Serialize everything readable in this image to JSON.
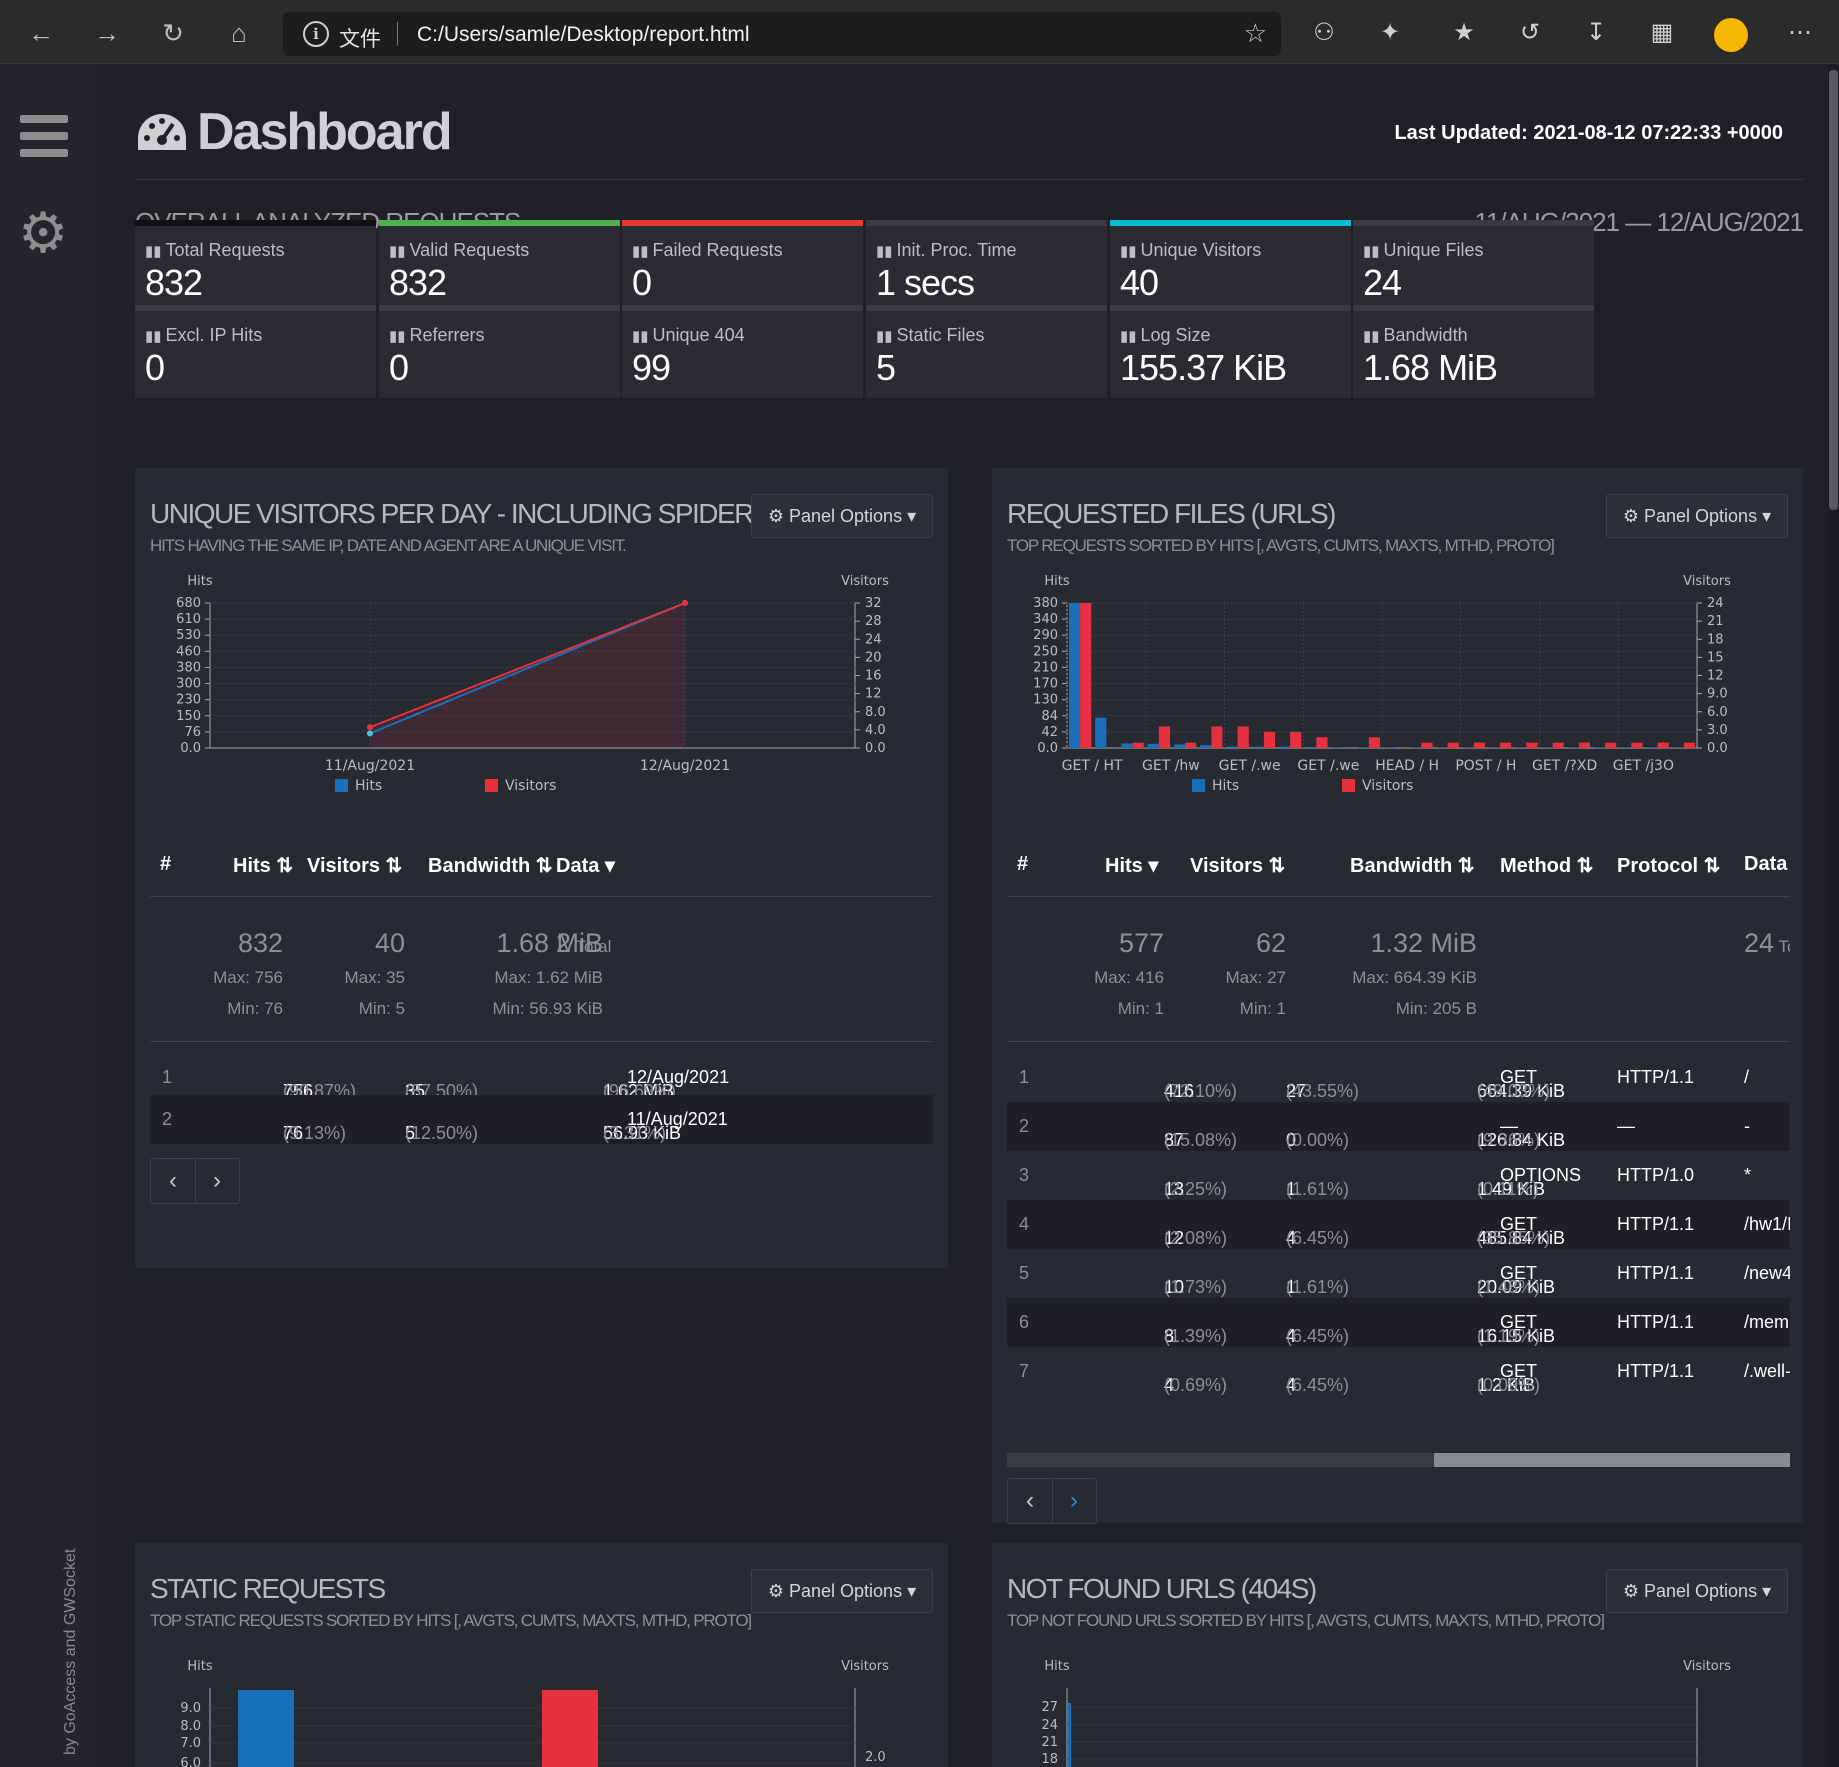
{
  "browser": {
    "file_label": "文件",
    "url": "C:/Users/samle/Desktop/report.html"
  },
  "sidebar": {
    "credit": "by GoAccess and GWSocket"
  },
  "header": {
    "title": "Dashboard",
    "last_updated": "Last Updated: 2021-08-12 07:22:33 +0000"
  },
  "overview": {
    "title": "OVERALL ANALYZED REQUESTS",
    "date_range": "11/AUG/2021 — 12/AUG/2021",
    "cards": [
      {
        "label": "Total Requests",
        "value": "832",
        "accent": "#111111"
      },
      {
        "label": "Valid Requests",
        "value": "832",
        "accent": "#4caf50"
      },
      {
        "label": "Failed Requests",
        "value": "0",
        "accent": "#e53935"
      },
      {
        "label": "Init. Proc. Time",
        "value": "1 secs",
        "accent": "#3a3c42"
      },
      {
        "label": "Unique Visitors",
        "value": "40",
        "accent": "#00bcd4"
      },
      {
        "label": "Unique Files",
        "value": "24",
        "accent": "#3a3c42"
      },
      {
        "label": "Excl. IP Hits",
        "value": "0",
        "accent": "#3a3c42"
      },
      {
        "label": "Referrers",
        "value": "0",
        "accent": "#3a3c42"
      },
      {
        "label": "Unique 404",
        "value": "99",
        "accent": "#3a3c42"
      },
      {
        "label": "Static Files",
        "value": "5",
        "accent": "#3a3c42"
      },
      {
        "label": "Log Size",
        "value": "155.37 KiB",
        "accent": "#3a3c42"
      },
      {
        "label": "Bandwidth",
        "value": "1.68 MiB",
        "accent": "#3a3c42"
      }
    ]
  },
  "panel_options_label": "Panel Options",
  "visitors_panel": {
    "title": "UNIQUE VISITORS PER DAY - INCLUDING SPIDERS",
    "subtitle": "HITS HAVING THE SAME IP, DATE AND AGENT ARE A UNIQUE VISIT.",
    "columns": [
      "#",
      "Hits",
      "Visitors",
      "Bandwidth",
      "Data"
    ],
    "summary": {
      "hits": "832",
      "hits_max": "Max: 756",
      "hits_min": "Min: 76",
      "visitors": "40",
      "visitors_max": "Max: 35",
      "visitors_min": "Min: 5",
      "bw": "1.68 MiB",
      "bw_max": "Max: 1.62 MiB",
      "bw_min": "Min: 56.93 KiB",
      "data": "2",
      "data_label": "Total"
    },
    "rows": [
      {
        "n": "1",
        "hits": "756",
        "hits_pct": "(90.87%)",
        "vis": "35",
        "vis_pct": "(87.50%)",
        "bw": "1.62 MiB",
        "bw_pct": "(96.69%)",
        "data": "12/Aug/2021"
      },
      {
        "n": "2",
        "hits": "76",
        "hits_pct": "(9.13%)",
        "vis": "5",
        "vis_pct": "(12.50%)",
        "bw": "56.93 KiB",
        "bw_pct": "(3.31%)",
        "data": "11/Aug/2021"
      }
    ]
  },
  "files_panel": {
    "title": "REQUESTED FILES (URLS)",
    "subtitle": "TOP REQUESTS SORTED BY HITS [, AVGTS, CUMTS, MAXTS, MTHD, PROTO]",
    "columns": [
      "#",
      "Hits",
      "Visitors",
      "Bandwidth",
      "Method",
      "Protocol",
      "Data"
    ],
    "summary": {
      "hits": "577",
      "hits_max": "Max: 416",
      "hits_min": "Min: 1",
      "visitors": "62",
      "visitors_max": "Max: 27",
      "visitors_min": "Min: 1",
      "bw": "1.32 MiB",
      "bw_max": "Max: 664.39 KiB",
      "bw_min": "Min: 205 B",
      "data": "24",
      "data_label": "Tc"
    },
    "rows": [
      {
        "n": "1",
        "hits": "416",
        "hits_pct": "(72.10%)",
        "vis": "27",
        "vis_pct": "(43.55%)",
        "bw": "664.39 KiB",
        "bw_pct": "(49.03%)",
        "method": "GET",
        "proto": "HTTP/1.1",
        "data": "/"
      },
      {
        "n": "2",
        "hits": "87",
        "hits_pct": "(15.08%)",
        "vis": "0",
        "vis_pct": "(0.00%)",
        "bw": "126.84 KiB",
        "bw_pct": "(9.36%)",
        "method": "—",
        "proto": "—",
        "data": "-"
      },
      {
        "n": "3",
        "hits": "13",
        "hits_pct": "(2.25%)",
        "vis": "1",
        "vis_pct": "(1.61%)",
        "bw": "1.49 KiB",
        "bw_pct": "(0.11%)",
        "method": "OPTIONS",
        "proto": "HTTP/1.0",
        "data": "*"
      },
      {
        "n": "4",
        "hits": "12",
        "hits_pct": "(2.08%)",
        "vis": "4",
        "vis_pct": "(6.45%)",
        "bw": "485.84 KiB",
        "bw_pct": "(35.85%)",
        "method": "GET",
        "proto": "HTTP/1.1",
        "data": "/hw1/I"
      },
      {
        "n": "5",
        "hits": "10",
        "hits_pct": "(1.73%)",
        "vis": "1",
        "vis_pct": "(1.61%)",
        "bw": "20.09 KiB",
        "bw_pct": "(1.48%)",
        "method": "GET",
        "proto": "HTTP/1.1",
        "data": "/new4"
      },
      {
        "n": "6",
        "hits": "8",
        "hits_pct": "(1.39%)",
        "vis": "4",
        "vis_pct": "(6.45%)",
        "bw": "16.15 KiB",
        "bw_pct": "(1.19%)",
        "method": "GET",
        "proto": "HTTP/1.1",
        "data": "/meml"
      },
      {
        "n": "7",
        "hits": "4",
        "hits_pct": "(0.69%)",
        "vis": "4",
        "vis_pct": "(6.45%)",
        "bw": "1.2 KiB",
        "bw_pct": "(0.09%)",
        "method": "GET",
        "proto": "HTTP/1.1",
        "data": "/.well-"
      }
    ]
  },
  "static_panel": {
    "title": "STATIC REQUESTS",
    "subtitle": "TOP STATIC REQUESTS SORTED BY HITS [, AVGTS, CUMTS, MAXTS, MTHD, PROTO]"
  },
  "notfound_panel": {
    "title": "NOT FOUND URLS (404S)",
    "subtitle": "TOP NOT FOUND URLS SORTED BY HITS [, AVGTS, CUMTS, MAXTS, MTHD, PROTO]"
  },
  "chart_data": [
    {
      "type": "line",
      "x": [
        "11/Aug/2021",
        "12/Aug/2021"
      ],
      "series": [
        {
          "name": "Hits",
          "values": [
            76,
            756
          ],
          "color": "#1a6fbd"
        },
        {
          "name": "Visitors",
          "values": [
            5,
            35
          ],
          "color": "#e8313f"
        }
      ],
      "ylabel": "Hits",
      "y2label": "Visitors",
      "yticks": [
        "0.0",
        "76",
        "150",
        "230",
        "300",
        "380",
        "460",
        "530",
        "610",
        "680"
      ],
      "y2ticks": [
        "0.0",
        "4.0",
        "8.0",
        "12",
        "16",
        "20",
        "24",
        "28",
        "32"
      ],
      "ylim": [
        0,
        756
      ],
      "y2lim": [
        0,
        35
      ],
      "legend": "bottom"
    },
    {
      "type": "bar",
      "categories": [
        "GET / HT",
        "",
        "GET /hw",
        "",
        "GET /.we",
        "",
        "GET /.we",
        "",
        "HEAD / H",
        "",
        "POST / H",
        "",
        "GET /?XD",
        "",
        "GET /j3O",
        "",
        "",
        "",
        "",
        "",
        "",
        "",
        "",
        ""
      ],
      "series": [
        {
          "name": "Hits",
          "values": [
            416,
            87,
            13,
            12,
            10,
            8,
            4,
            4,
            4,
            3,
            2,
            2,
            2,
            1,
            1,
            1,
            1,
            1,
            1,
            1,
            1,
            1,
            1,
            1
          ],
          "color": "#1a6fbd"
        },
        {
          "name": "Visitors",
          "values": [
            27,
            0,
            1,
            4,
            1,
            4,
            4,
            3,
            3,
            2,
            0,
            2,
            0,
            1,
            1,
            1,
            1,
            1,
            1,
            1,
            1,
            1,
            1,
            1
          ],
          "color": "#e8313f"
        }
      ],
      "xticklabels": [
        "GET / HT",
        "GET /hw",
        "GET /.we",
        "GET /.we",
        "HEAD / H",
        "POST / H",
        "GET /?XD",
        "GET /j3O"
      ],
      "ylabel": "Hits",
      "y2label": "Visitors",
      "yticks": [
        "0.0",
        "42",
        "84",
        "130",
        "170",
        "210",
        "250",
        "290",
        "340",
        "380"
      ],
      "y2ticks": [
        "0.0",
        "3.0",
        "6.0",
        "9.0",
        "12",
        "15",
        "18",
        "21",
        "24"
      ],
      "ylim": [
        0,
        416
      ],
      "y2lim": [
        0,
        27
      ],
      "legend": "bottom"
    },
    {
      "type": "bar",
      "ylabel": "Hits",
      "y2label": "Visitors",
      "yticks": [
        "6.0",
        "7.0",
        "8.0",
        "9.0"
      ],
      "y2ticks": [
        "2.0"
      ],
      "series": [
        {
          "name": "Hits",
          "values": [
            10
          ],
          "color": "#1a6fbd"
        },
        {
          "name": "Visitors",
          "values": [
            3
          ],
          "color": "#e8313f"
        }
      ]
    },
    {
      "type": "bar",
      "ylabel": "Hits",
      "y2label": "Visitors",
      "yticks": [
        "18",
        "21",
        "24",
        "27"
      ],
      "series": [
        {
          "name": "Hits",
          "values": [
            28
          ],
          "color": "#1a6fbd"
        }
      ]
    }
  ]
}
